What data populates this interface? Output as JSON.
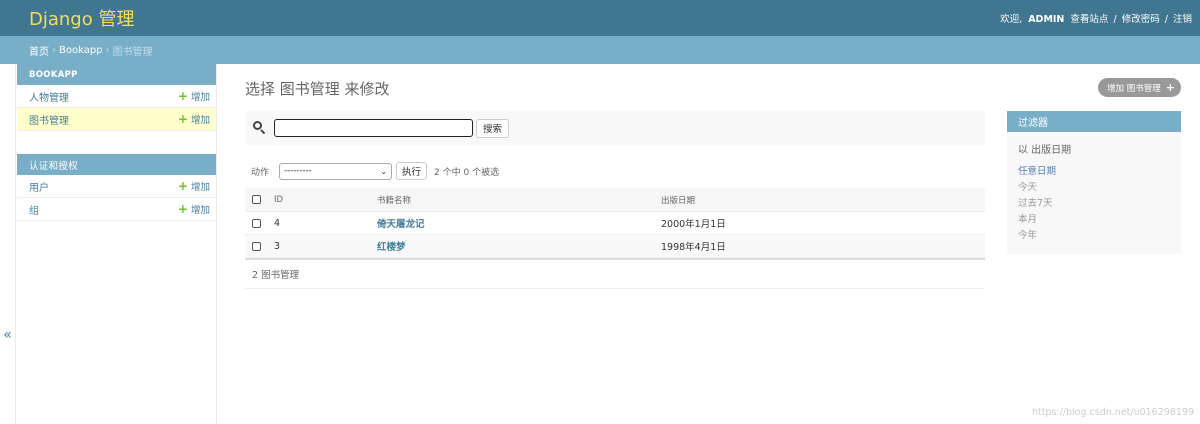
{
  "header": {
    "site_name": "Django 管理",
    "welcome": "欢迎,",
    "username": "ADMIN",
    "view_site": "查看站点",
    "change_password": "修改密码",
    "logout": "注销",
    "separator": "/"
  },
  "breadcrumbs": {
    "home": "首页",
    "app": "Bookapp",
    "current": "图书管理",
    "arrow": "›"
  },
  "toggle_nav": {
    "icon": "«"
  },
  "sidebar": {
    "modules": [
      {
        "caption": "BOOKAPP",
        "rows": [
          {
            "label": "人物管理",
            "add": "增加"
          },
          {
            "label": "图书管理",
            "add": "增加"
          }
        ]
      },
      {
        "caption": "认证和授权",
        "rows": [
          {
            "label": "用户",
            "add": "增加"
          },
          {
            "label": "组",
            "add": "增加"
          }
        ]
      }
    ]
  },
  "main": {
    "title": "选择 图书管理 来修改",
    "add_button": "增加 图书管理",
    "search": {
      "value": "",
      "button": "搜索"
    },
    "actions": {
      "label": "动作",
      "selected_option": "---------",
      "run_button": "执行",
      "counter": "2 个中 0 个被选"
    },
    "table": {
      "columns": [
        "ID",
        "书籍名称",
        "出版日期"
      ],
      "rows": [
        {
          "id": "4",
          "name": "倚天屠龙记",
          "date": "2000年1月1日"
        },
        {
          "id": "3",
          "name": "红楼梦",
          "date": "1998年4月1日"
        }
      ]
    },
    "paginator": "2 图书管理"
  },
  "filter": {
    "title": "过滤器",
    "subtitle": "以 出版日期",
    "choices": [
      "任意日期",
      "今天",
      "过去7天",
      "本月",
      "今年"
    ]
  },
  "watermark": "https://blog.csdn.net/u016298199",
  "colors": {
    "header_bg": "#417690",
    "site_name": "#f5dd5d",
    "breadcrumbs_bg": "#79aec8",
    "link": "#447e9b",
    "current_row": "#ffffcc",
    "add_icon": "#70bf2b"
  }
}
